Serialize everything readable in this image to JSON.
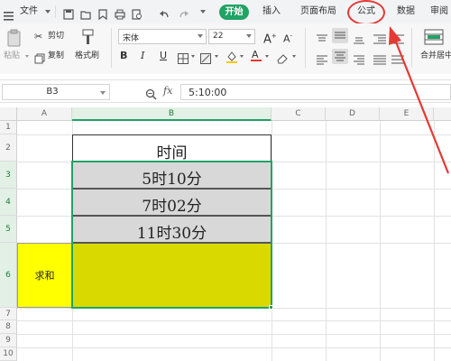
{
  "menubar": {
    "file_label": "文件",
    "start_label": "开始",
    "tabs": [
      "插入",
      "页面布局",
      "公式",
      "数据",
      "审阅"
    ]
  },
  "ribbon": {
    "paste_label": "粘贴",
    "cut_label": "剪切",
    "copy_label": "复制",
    "format_painter_label": "格式刷",
    "font_name": "宋体",
    "font_size": "22",
    "bold": "B",
    "italic": "I",
    "underline": "U",
    "merge_label": "合并居中"
  },
  "formulabar": {
    "cell_ref": "B3",
    "fx_label": "fx",
    "formula": "5:10:00"
  },
  "grid": {
    "columns": [
      "A",
      "B",
      "C",
      "D",
      "E"
    ],
    "rows": [
      "1",
      "2",
      "3",
      "4",
      "5",
      "6",
      "7",
      "8",
      "9",
      "10"
    ],
    "cells": {
      "B2": "时间",
      "B3": "5时10分",
      "B4": "7时02分",
      "B5": "11时30分",
      "A6": "求和"
    }
  },
  "colors": {
    "accent": "#21a366",
    "annotation": "#e53935",
    "sum_fill": "#d9d900",
    "label_fill": "#ffff00",
    "value_fill": "#d8d8d8"
  }
}
